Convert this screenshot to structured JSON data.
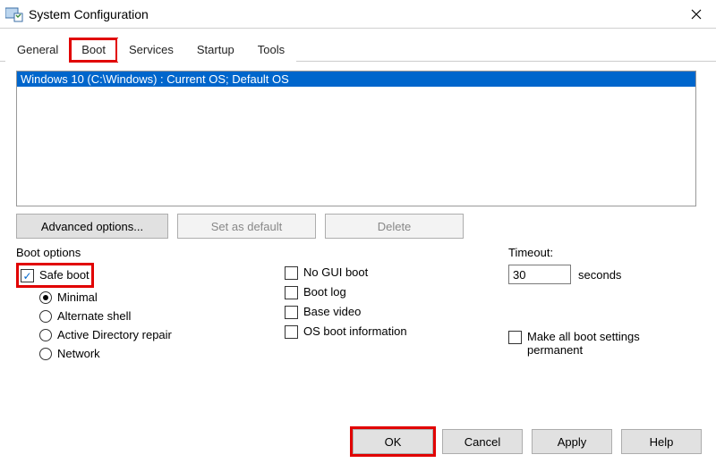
{
  "title": "System Configuration",
  "tabs": {
    "general": "General",
    "boot": "Boot",
    "services": "Services",
    "startup": "Startup",
    "tools": "Tools"
  },
  "active_tab": "Boot",
  "os_entry": "Windows 10 (C:\\Windows) : Current OS; Default OS",
  "buttons": {
    "advanced": "Advanced options...",
    "set_default": "Set as default",
    "delete": "Delete",
    "ok": "OK",
    "cancel": "Cancel",
    "apply": "Apply",
    "help": "Help"
  },
  "boot_options_label": "Boot options",
  "safe_boot": "Safe boot",
  "safe_modes": {
    "minimal": "Minimal",
    "altshell": "Alternate shell",
    "adrepair": "Active Directory repair",
    "network": "Network"
  },
  "mid_checks": {
    "nogui": "No GUI boot",
    "bootlog": "Boot log",
    "basevideo": "Base video",
    "osinfo": "OS boot information"
  },
  "timeout_label": "Timeout:",
  "timeout_value": "30",
  "timeout_unit": "seconds",
  "permanent": "Make all boot settings permanent"
}
